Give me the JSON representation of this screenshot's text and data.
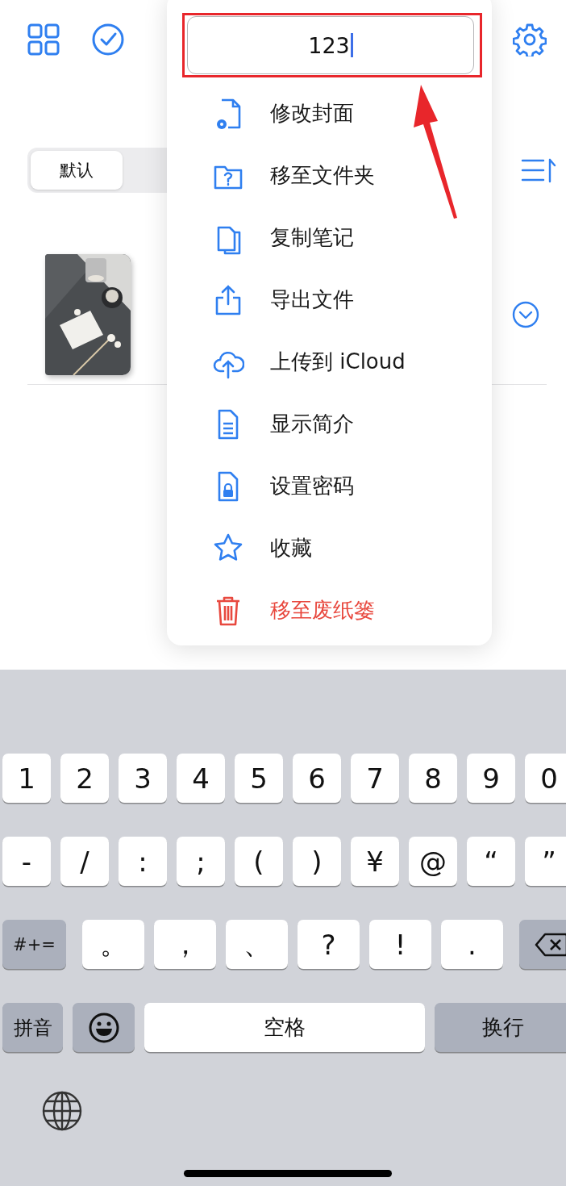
{
  "segments": [
    {
      "label": "默认",
      "selected": true
    }
  ],
  "menu": {
    "field": {
      "value": "123"
    },
    "items": [
      {
        "label": "修改封面",
        "kind": "normal"
      },
      {
        "label": "移至文件夹",
        "kind": "normal"
      },
      {
        "label": "复制笔记",
        "kind": "normal"
      },
      {
        "label": "导出文件",
        "kind": "normal"
      },
      {
        "label": "上传到 iCloud",
        "kind": "normal"
      },
      {
        "label": "显示简介",
        "kind": "normal"
      },
      {
        "label": "设置密码",
        "kind": "normal"
      },
      {
        "label": "收藏",
        "kind": "normal"
      },
      {
        "label": "移至废纸篓",
        "kind": "destructive"
      }
    ]
  },
  "keyboard": {
    "rows": [
      {
        "keys": [
          {
            "kind": "char",
            "label": "1"
          },
          {
            "kind": "char",
            "label": "2"
          },
          {
            "kind": "char",
            "label": "3"
          },
          {
            "kind": "char",
            "label": "4"
          },
          {
            "kind": "char",
            "label": "5"
          },
          {
            "kind": "char",
            "label": "6"
          },
          {
            "kind": "char",
            "label": "7"
          },
          {
            "kind": "char",
            "label": "8"
          },
          {
            "kind": "char",
            "label": "9"
          },
          {
            "kind": "char",
            "label": "0"
          }
        ]
      },
      {
        "keys": [
          {
            "kind": "char",
            "label": "-"
          },
          {
            "kind": "char",
            "label": "/"
          },
          {
            "kind": "char",
            "label": ":"
          },
          {
            "kind": "char",
            "label": ";"
          },
          {
            "kind": "char",
            "label": "("
          },
          {
            "kind": "char",
            "label": ")"
          },
          {
            "kind": "char",
            "label": "¥"
          },
          {
            "kind": "char",
            "label": "@"
          },
          {
            "kind": "char",
            "label": "“"
          },
          {
            "kind": "char",
            "label": "”"
          }
        ]
      },
      {
        "keys": [
          {
            "kind": "function",
            "label": "#+="
          },
          {
            "kind": "punct",
            "label": "。"
          },
          {
            "kind": "punct",
            "label": "，"
          },
          {
            "kind": "punct",
            "label": "、"
          },
          {
            "kind": "punct",
            "label": "?"
          },
          {
            "kind": "punct",
            "label": "!"
          },
          {
            "kind": "punct",
            "label": "."
          },
          {
            "kind": "delete"
          }
        ]
      },
      {
        "keys": [
          {
            "kind": "function",
            "label": "拼音"
          },
          {
            "kind": "emoji"
          },
          {
            "kind": "space",
            "label": "空格"
          },
          {
            "kind": "return",
            "label": "换行"
          }
        ]
      },
      {
        "keys": [
          {
            "kind": "globe"
          }
        ]
      }
    ]
  }
}
